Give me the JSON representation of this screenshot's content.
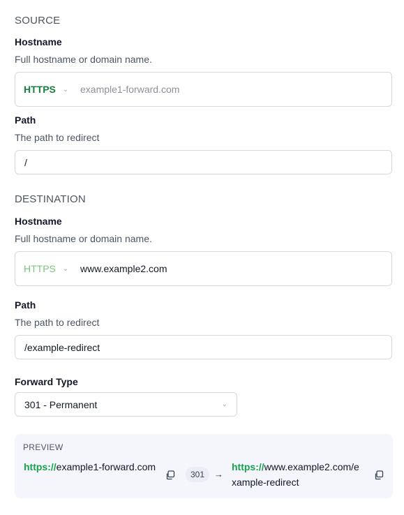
{
  "source": {
    "section_title": "SOURCE",
    "hostname_label": "Hostname",
    "hostname_help": "Full hostname or domain name.",
    "protocol": "HTTPS",
    "hostname_placeholder": "example1-forward.com",
    "path_label": "Path",
    "path_help": "The path to redirect",
    "path_value": "/"
  },
  "destination": {
    "section_title": "DESTINATION",
    "hostname_label": "Hostname",
    "hostname_help": "Full hostname or domain name.",
    "protocol": "HTTPS",
    "hostname_value": "www.example2.com",
    "path_label": "Path",
    "path_help": "The path to redirect",
    "path_value": "/example-redirect"
  },
  "forward_type": {
    "label": "Forward Type",
    "selected": "301 - Permanent"
  },
  "preview": {
    "title": "PREVIEW",
    "source_scheme": "https://",
    "source_rest": "example1-forward.com",
    "code": "301",
    "arrow": "→",
    "dest_scheme": "https://",
    "dest_rest": "www.example2.com/example-redirect"
  },
  "colors": {
    "scheme_green": "#16a34a",
    "protocol_green": "#15803d",
    "protocol_green_light": "#7bc47b",
    "preview_bg": "#f5f5fc"
  },
  "icons": {
    "protocol_chevron": "chevron-down-icon",
    "select_chevron": "chevron-down-icon",
    "copy": "copy-icon",
    "arrow": "arrow-right-icon"
  }
}
